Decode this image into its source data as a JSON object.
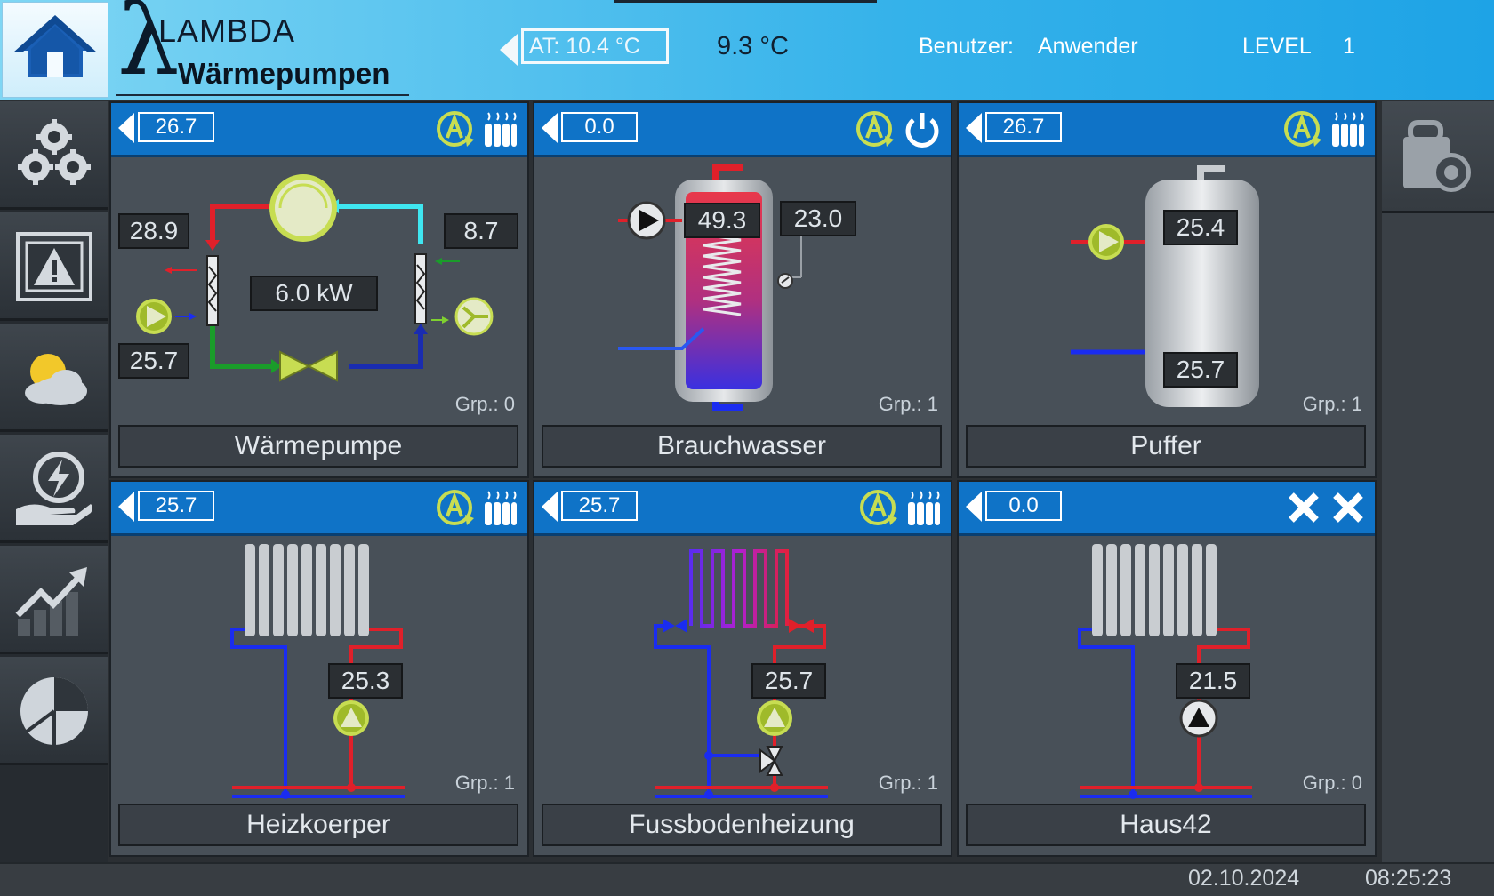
{
  "header": {
    "brand": "LAMBDA",
    "brand_sub": "Wärmepumpen",
    "outdoor_setting": "AT: 10.4 °C",
    "outdoor_temp": "9.3 °C",
    "user_label": "Benutzer:",
    "user_name": "Anwender",
    "level_label": "LEVEL",
    "level_value": "1"
  },
  "sidebar": [
    "gear-icon",
    "warning-icon",
    "weather-icon",
    "energy-icon",
    "trend-icon",
    "pie-chart-icon"
  ],
  "rightbar": [
    "settings-lock-icon"
  ],
  "panels": [
    {
      "name": "Wärmepumpe",
      "header_value": "26.7",
      "grp": "Grp.: 0",
      "icons": [
        "auto-mode-icon",
        "heating-icon"
      ],
      "values": {
        "flow": "28.9",
        "return": "25.7",
        "source_in": "8.7",
        "power": "6.0 kW"
      }
    },
    {
      "name": "Brauchwasser",
      "header_value": "0.0",
      "grp": "Grp.: 1",
      "icons": [
        "auto-mode-icon",
        "power-icon"
      ],
      "values": {
        "tank": "49.3",
        "setpoint": "23.0"
      }
    },
    {
      "name": "Puffer",
      "header_value": "26.7",
      "grp": "Grp.: 1",
      "icons": [
        "auto-mode-icon",
        "heating-icon"
      ],
      "values": {
        "top": "25.4",
        "bottom": "25.7"
      }
    },
    {
      "name": "Heizkoerper",
      "header_value": "25.7",
      "grp": "Grp.: 1",
      "icons": [
        "auto-mode-icon",
        "heating-icon"
      ],
      "values": {
        "flow": "25.3"
      }
    },
    {
      "name": "Fussbodenheizung",
      "header_value": "25.7",
      "grp": "Grp.: 1",
      "icons": [
        "auto-mode-icon",
        "heating-icon"
      ],
      "values": {
        "flow": "25.7"
      }
    },
    {
      "name": "Haus42",
      "header_value": "0.0",
      "grp": "Grp.: 0",
      "icons": [
        "disabled-x-icon",
        "disabled-x-icon"
      ],
      "values": {
        "flow": "21.5"
      }
    }
  ],
  "footer": {
    "date": "02.10.2024",
    "time": "08:25:23"
  },
  "colors": {
    "header_blue": "#0f73c7",
    "panel_bg": "#485058",
    "pump_green": "#c7dd52",
    "flow_red": "#e0202a",
    "return_blue": "#1a2cf0"
  }
}
